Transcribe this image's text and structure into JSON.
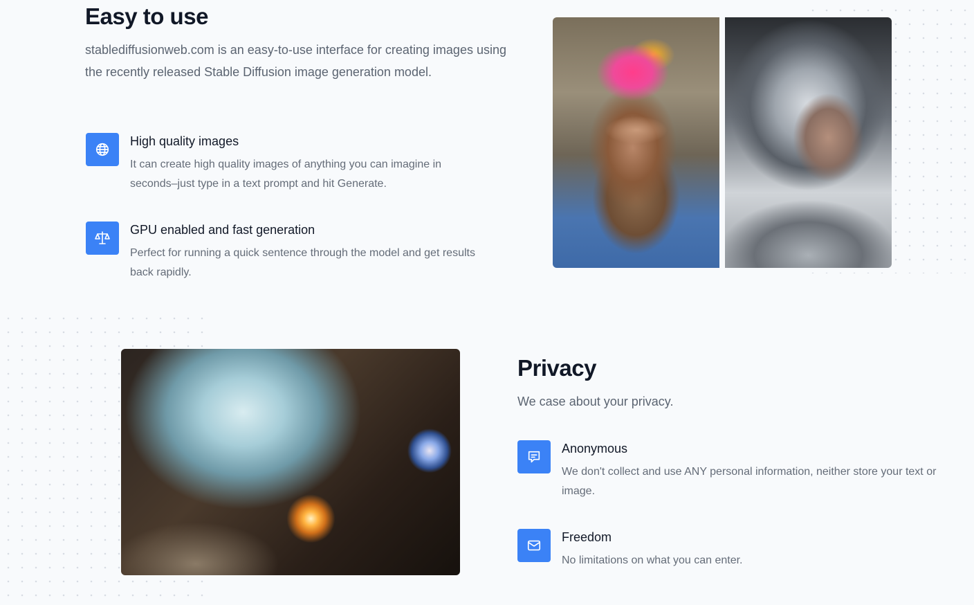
{
  "easy": {
    "title": "Easy to use",
    "lead": "stablediffusionweb.com is an easy-to-use interface for creating images using the recently released Stable Diffusion image generation model.",
    "features": [
      {
        "icon": "globe-icon",
        "title": "High quality images",
        "description": "It can create high quality images of anything you can imagine in seconds–just type in a text prompt and hit Generate."
      },
      {
        "icon": "scale-icon",
        "title": "GPU enabled and fast generation",
        "description": "Perfect for running a quick sentence through the model and get results back rapidly."
      }
    ]
  },
  "privacy": {
    "title": "Privacy",
    "lead": "We case about your privacy.",
    "features": [
      {
        "icon": "chat-icon",
        "title": "Anonymous",
        "description": "We don't collect and use ANY personal information, neither store your text or image."
      },
      {
        "icon": "mail-icon",
        "title": "Freedom",
        "description": "No limitations on what you can enter."
      }
    ]
  },
  "colors": {
    "accent": "#3b82f6",
    "background": "#f8fafc",
    "heading": "#111827",
    "body_text": "#5b6471"
  }
}
